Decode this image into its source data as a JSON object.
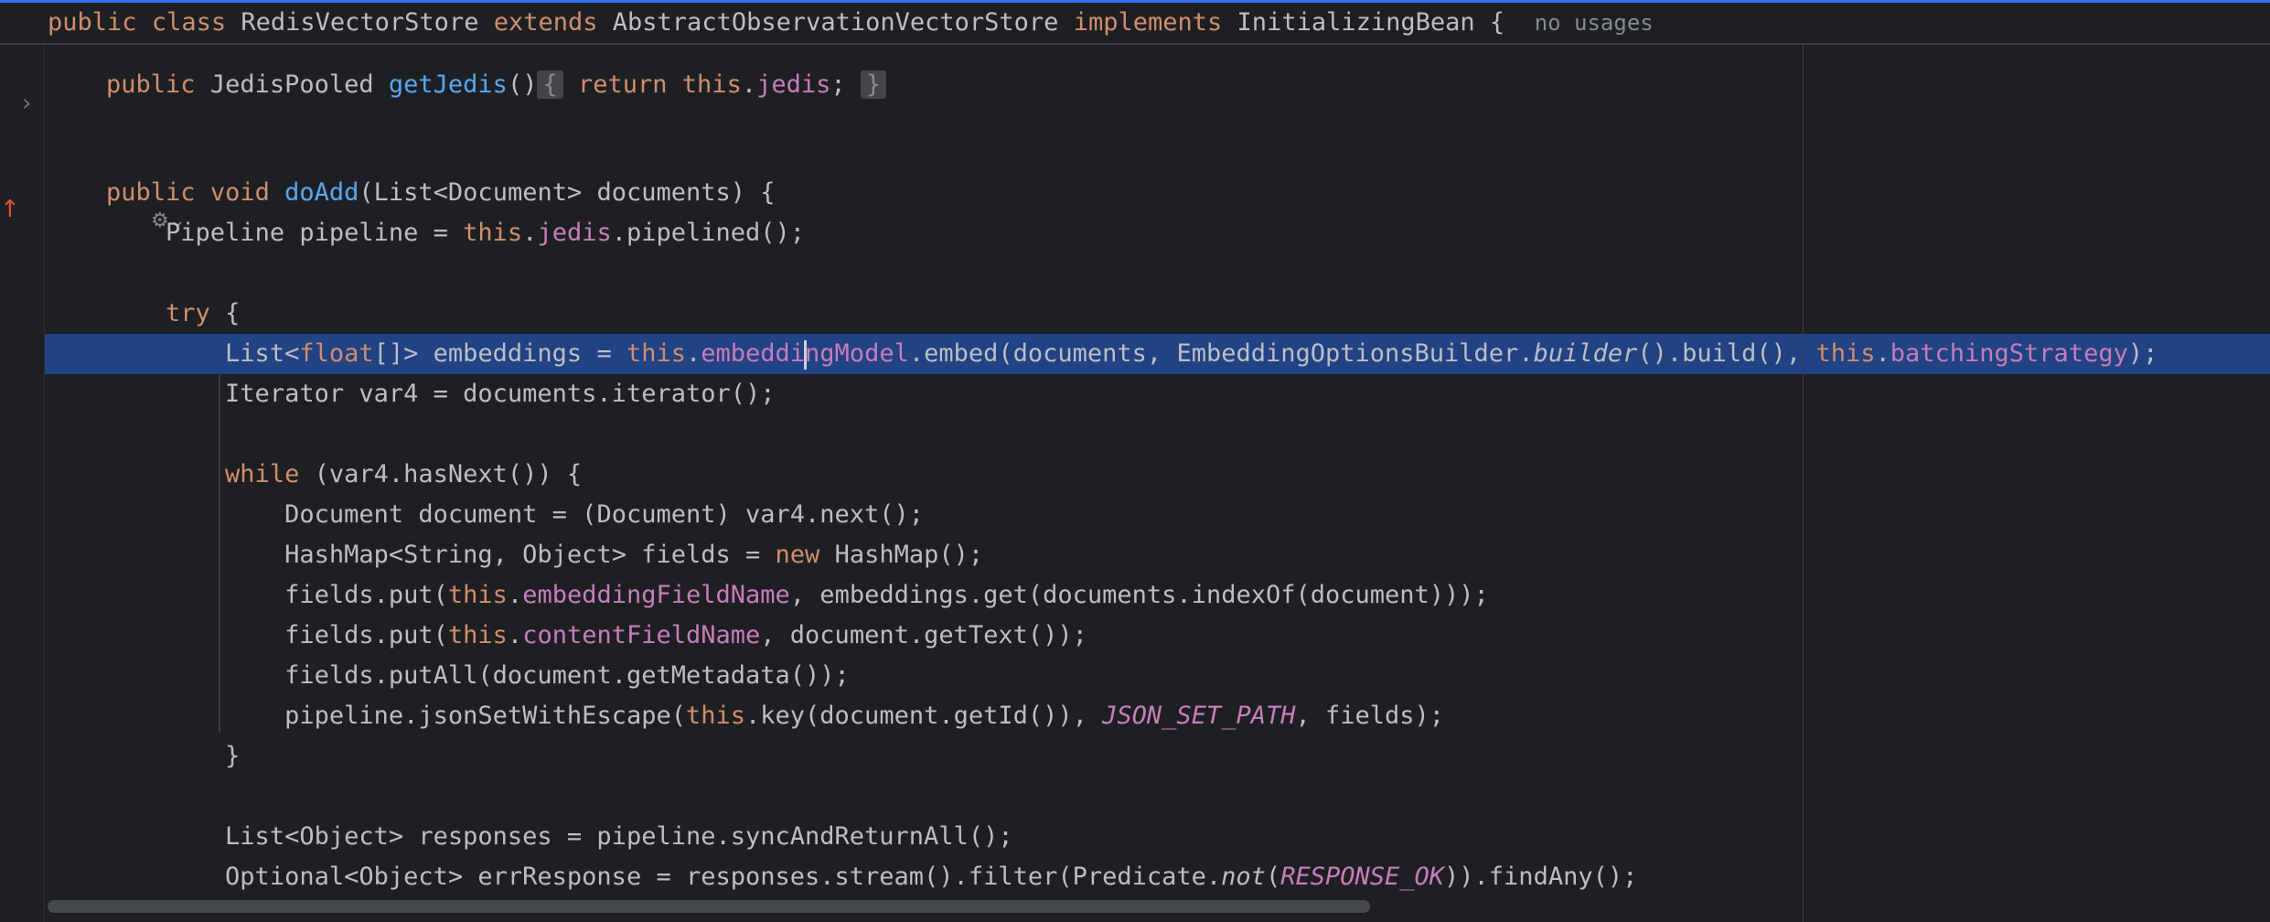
{
  "sticky_header": {
    "public": "public",
    "class": "class",
    "class_name": "RedisVectorStore",
    "extends": "extends",
    "superclass": "AbstractObservationVectorStore",
    "implements": "implements",
    "interface": "InitializingBean",
    "brace": "{",
    "usages": "no usages"
  },
  "line_getjedis": {
    "public": "public",
    "type": "JedisPooled",
    "method": "getJedis",
    "parens": "()",
    "fold_open": "{",
    "return": "return",
    "this": "this",
    "dot": ".",
    "field": "jedis",
    "semi": ";",
    "fold_close": "}"
  },
  "line_doadd": {
    "public": "public",
    "void": "void",
    "method": "doAdd",
    "params": "(List<Document> documents) {"
  },
  "line_pipeline": {
    "prefix": "Pipeline pipeline = ",
    "this": "this",
    "dot": ".",
    "field": "jedis",
    "suffix": ".pipelined();"
  },
  "line_try": {
    "try": "try",
    "brace": "{"
  },
  "line_embeddings": {
    "prefix": "List<",
    "float": "float",
    "mid": "[]> embeddings = ",
    "this1": "this",
    "dot1": ".",
    "field1a": "embeddi",
    "field1b": "ngModel",
    "call": ".embed(documents, EmbeddingOptionsBuilder.",
    "builder": "builder",
    "build": "().build(), ",
    "this2": "this",
    "dot2": ".",
    "field2": "batchingStrategy",
    "end": ");"
  },
  "line_iterator": {
    "text": "Iterator var4 = documents.iterator();"
  },
  "line_while": {
    "while": "while",
    "rest": "(var4.hasNext()) {"
  },
  "line_document": {
    "text": "Document document = (Document) var4.next();"
  },
  "line_hashmap": {
    "prefix": "HashMap<String, Object> fields = ",
    "new": "new",
    "suffix": "HashMap();"
  },
  "line_put1": {
    "prefix": "fields.put(",
    "this": "this",
    "dot": ".",
    "field": "embeddingFieldName",
    "suffix": ", embeddings.get(documents.indexOf(document)));"
  },
  "line_put2": {
    "prefix": "fields.put(",
    "this": "this",
    "dot": ".",
    "field": "contentFieldName",
    "suffix": ", document.getText());"
  },
  "line_putall": {
    "text": "fields.putAll(document.getMetadata());"
  },
  "line_jsonset": {
    "prefix": "pipeline.jsonSetWithEscape(",
    "this": "this",
    "mid": ".key(document.getId()), ",
    "const": "JSON_SET_PATH",
    "suffix": ", fields);"
  },
  "line_close": {
    "text": "}"
  },
  "line_responses": {
    "text": "List<Object> responses = pipeline.syncAndReturnAll();"
  },
  "line_err": {
    "prefix": "Optional<Object> errResponse = responses.stream().filter(Predicate.",
    "not": "not",
    "paren": "(",
    "const": "RESPONSE_OK",
    "suffix": ")).findAny();"
  },
  "icons": {
    "expand": "chevron-right-icon",
    "override": "override-marker-icon",
    "ai": "ai-assistant-icon"
  },
  "colors": {
    "background": "#1e1f22",
    "keyword": "#cf8e6d",
    "method": "#56a8f5",
    "field": "#c77dbb",
    "text": "#bcbec4",
    "current_line": "#214283",
    "hint": "#868a91"
  }
}
